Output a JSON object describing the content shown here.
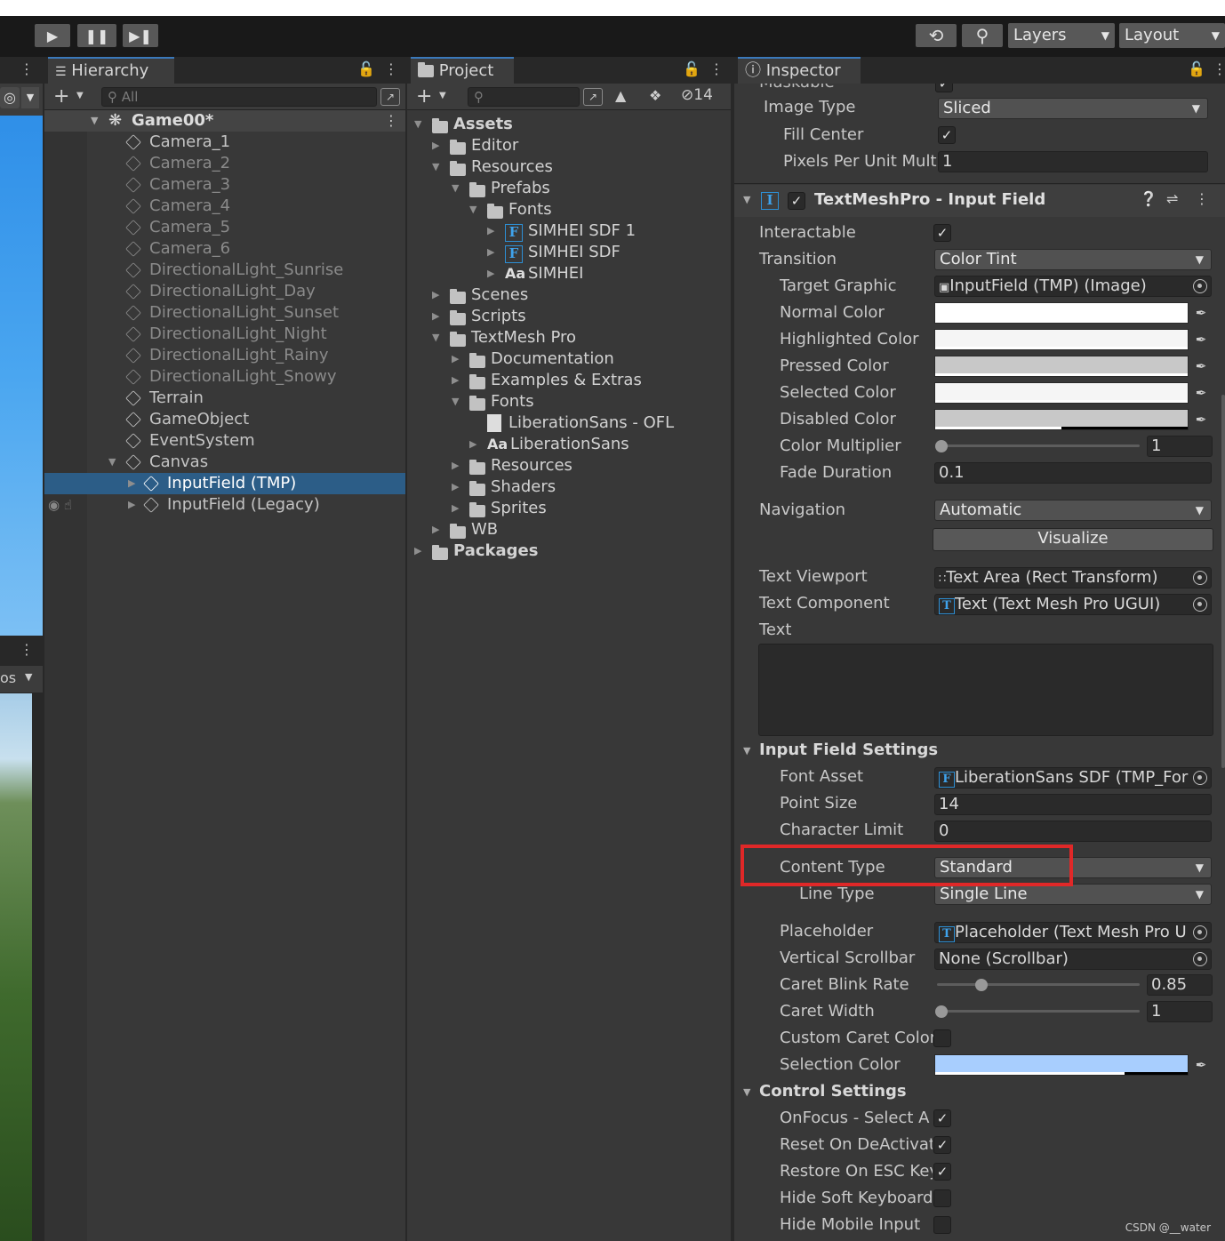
{
  "toolbar": {
    "play_icon": "play-icon",
    "pause_icon": "pause-icon",
    "step_icon": "step-icon",
    "history_icon": "history-icon",
    "search_icon": "search-icon",
    "layers_label": "Layers",
    "layout_label": "Layout"
  },
  "hierarchy": {
    "tab_label": "Hierarchy",
    "search_placeholder": "All",
    "scene_name": "Game00*",
    "items": [
      {
        "label": "Camera_1",
        "dim": false
      },
      {
        "label": "Camera_2",
        "dim": true
      },
      {
        "label": "Camera_3",
        "dim": true
      },
      {
        "label": "Camera_4",
        "dim": true
      },
      {
        "label": "Camera_5",
        "dim": true
      },
      {
        "label": "Camera_6",
        "dim": true
      },
      {
        "label": "DirectionalLight_Sunrise",
        "dim": true
      },
      {
        "label": "DirectionalLight_Day",
        "dim": true
      },
      {
        "label": "DirectionalLight_Sunset",
        "dim": true
      },
      {
        "label": "DirectionalLight_Night",
        "dim": true
      },
      {
        "label": "DirectionalLight_Rainy",
        "dim": true
      },
      {
        "label": "DirectionalLight_Snowy",
        "dim": true
      },
      {
        "label": "Terrain",
        "dim": false
      },
      {
        "label": "GameObject",
        "dim": false
      },
      {
        "label": "EventSystem",
        "dim": false
      },
      {
        "label": "Canvas",
        "dim": false
      },
      {
        "label": "InputField (TMP)",
        "dim": false,
        "selected": true
      },
      {
        "label": "InputField (Legacy)",
        "dim": false
      }
    ]
  },
  "scene_view": {
    "overflow_label": "os"
  },
  "project": {
    "tab_label": "Project",
    "hidden_count": "14",
    "tree": [
      {
        "label": "Assets",
        "bold": true
      },
      {
        "label": "Editor"
      },
      {
        "label": "Resources"
      },
      {
        "label": "Prefabs"
      },
      {
        "label": "Fonts"
      },
      {
        "label": "SIMHEI SDF 1"
      },
      {
        "label": "SIMHEI SDF"
      },
      {
        "label": "SIMHEI"
      },
      {
        "label": "Scenes"
      },
      {
        "label": "Scripts"
      },
      {
        "label": "TextMesh Pro"
      },
      {
        "label": "Documentation"
      },
      {
        "label": "Examples & Extras"
      },
      {
        "label": "Fonts"
      },
      {
        "label": "LiberationSans - OFL"
      },
      {
        "label": "LiberationSans"
      },
      {
        "label": "Resources"
      },
      {
        "label": "Shaders"
      },
      {
        "label": "Sprites"
      },
      {
        "label": "WB"
      },
      {
        "label": "Packages",
        "bold": true
      }
    ],
    "font_icon_letter": "F",
    "aa_label": "Aa"
  },
  "inspector": {
    "tab_label": "Inspector",
    "top_cut_label": "Maskable",
    "image_type": {
      "label": "Image Type",
      "value": "Sliced"
    },
    "fill_center": {
      "label": "Fill Center",
      "checked": true
    },
    "pixels_per_unit": {
      "label": "Pixels Per Unit Mult",
      "value": "1"
    },
    "component": {
      "title": "TextMeshPro - Input Field",
      "icon_letter": "I",
      "enabled": true
    },
    "interactable": {
      "label": "Interactable",
      "checked": true
    },
    "transition": {
      "label": "Transition",
      "value": "Color Tint"
    },
    "target_graphic": {
      "label": "Target Graphic",
      "value": "InputField (TMP) (Image)"
    },
    "colors": [
      {
        "label": "Normal Color",
        "color": "#ffffff",
        "alpha": 1.0
      },
      {
        "label": "Highlighted Color",
        "color": "#f5f5f5",
        "alpha": 1.0
      },
      {
        "label": "Pressed Color",
        "color": "#c8c8c8",
        "alpha": 1.0
      },
      {
        "label": "Selected Color",
        "color": "#f5f5f5",
        "alpha": 1.0
      },
      {
        "label": "Disabled Color",
        "color": "#c8c8c8",
        "alpha": 0.5
      }
    ],
    "color_multiplier": {
      "label": "Color Multiplier",
      "value": "1",
      "slider_fraction": 0.0
    },
    "fade_duration": {
      "label": "Fade Duration",
      "value": "0.1"
    },
    "navigation": {
      "label": "Navigation",
      "value": "Automatic"
    },
    "visualize_label": "Visualize",
    "text_viewport": {
      "label": "Text Viewport",
      "value": "Text Area (Rect Transform)"
    },
    "text_component": {
      "label": "Text Component",
      "value": "Text (Text Mesh Pro UGUI)",
      "icon_letter": "T"
    },
    "text_label": "Text",
    "text_value": "",
    "input_field_settings": {
      "header": "Input Field Settings",
      "font_asset": {
        "label": "Font Asset",
        "value": "LiberationSans SDF (TMP_For",
        "icon_letter": "F"
      },
      "point_size": {
        "label": "Point Size",
        "value": "14"
      },
      "character_limit": {
        "label": "Character Limit",
        "value": "0"
      },
      "content_type": {
        "label": "Content Type",
        "value": "Standard"
      },
      "line_type": {
        "label": "Line Type",
        "value": "Single Line"
      },
      "placeholder": {
        "label": "Placeholder",
        "value": "Placeholder (Text Mesh Pro U",
        "icon_letter": "T"
      },
      "vertical_scrollbar": {
        "label": "Vertical Scrollbar",
        "value": "None (Scrollbar)"
      },
      "caret_blink_rate": {
        "label": "Caret Blink Rate",
        "value": "0.85",
        "slider_fraction": 0.2
      },
      "caret_width": {
        "label": "Caret Width",
        "value": "1",
        "slider_fraction": 0.0
      },
      "custom_caret_color": {
        "label": "Custom Caret Color",
        "checked": false
      },
      "selection_color": {
        "label": "Selection Color",
        "color": "#a8cefe",
        "alpha": 0.75
      }
    },
    "control_settings": {
      "header": "Control Settings",
      "items": [
        {
          "label": "OnFocus - Select A",
          "checked": true
        },
        {
          "label": "Reset On DeActivat",
          "checked": true
        },
        {
          "label": "Restore On ESC Key",
          "checked": true
        },
        {
          "label": "Hide Soft Keyboard",
          "checked": false
        },
        {
          "label": "Hide Mobile Input",
          "checked": false
        }
      ]
    }
  },
  "watermark": "CSDN @__water",
  "colors": {
    "selection_highlight": "#2c5d87",
    "tab_accent": "#3a79bb",
    "annotation_red": "#e02828"
  }
}
